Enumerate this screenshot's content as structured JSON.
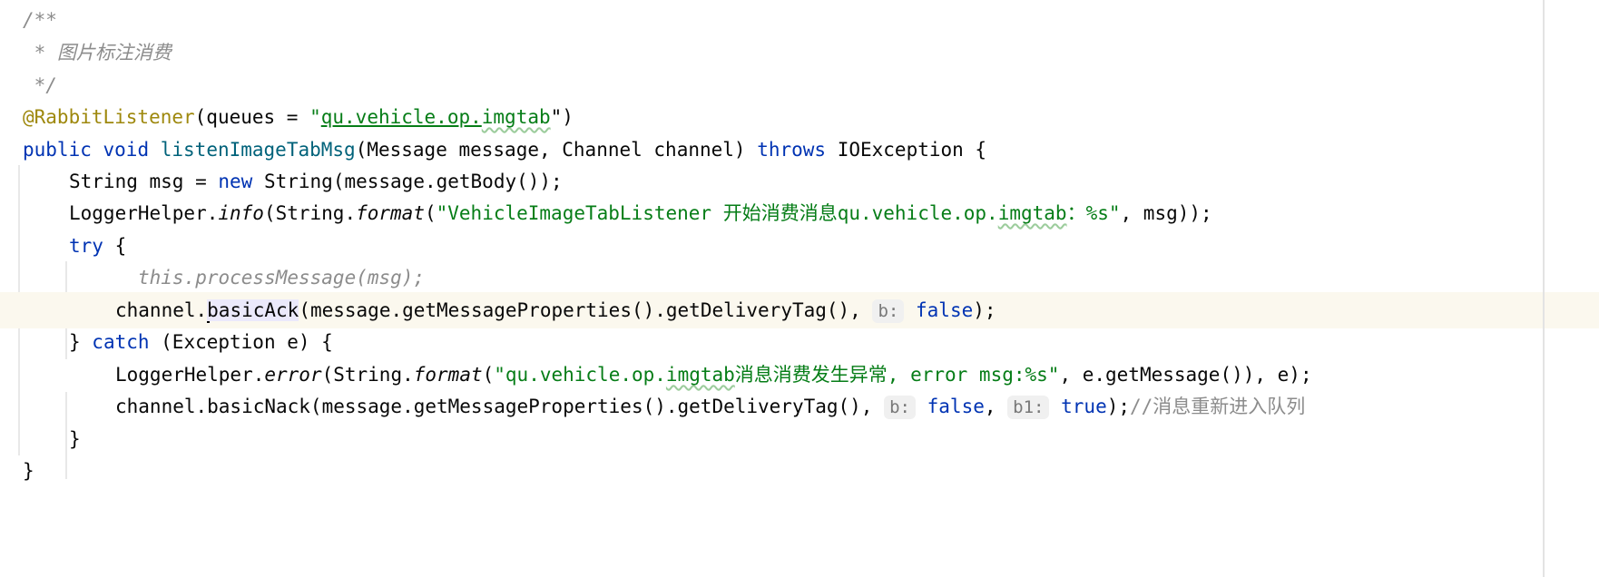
{
  "editor": {
    "language": "java",
    "comment_open": "/**",
    "comment_text": " * 图片标注消费",
    "comment_close": " */",
    "annotation": "@RabbitListener",
    "annotation_args_prefix": "(queues = ",
    "queue_quote_open": "\"",
    "queue_name_underlined": "qu.vehicle.op.",
    "queue_name_typo": "imgtab",
    "queue_quote_close": "\")",
    "sig_public": "public",
    "sig_void": "void",
    "method_name": "listenImageTabMsg",
    "sig_params": "(Message message, Channel channel) ",
    "sig_throws": "throws",
    "sig_exception": " IOException {",
    "line_msg_1": "String msg = ",
    "line_msg_new": "new",
    "line_msg_2": " String(message.getBody());",
    "log_info_1": "LoggerHelper.",
    "log_info_method": "info",
    "log_info_2": "(String.",
    "log_info_format": "format",
    "log_info_3": "(",
    "log_info_str_1": "\"VehicleImageTabListener 开始消费消息qu.vehicle.op.",
    "log_info_str_typo": "imgtab",
    "log_info_str_2": "：%s\"",
    "log_info_4": ", msg));",
    "try_kw": "try",
    "try_brace": " {",
    "process_call": "this.processMessage(msg);",
    "ack_1": "channel.",
    "ack_method": "basicAck",
    "ack_2": "(message.getMessageProperties().getDeliveryTag(), ",
    "ack_hint": "b:",
    "ack_false": "false",
    "ack_3": ");",
    "catch_brace_open": "} ",
    "catch_kw": "catch",
    "catch_rest": " (Exception e) {",
    "log_err_1": "LoggerHelper.",
    "log_err_method": "error",
    "log_err_2": "(String.",
    "log_err_format": "format",
    "log_err_3": "(",
    "log_err_str_1": "\"qu.vehicle.op.",
    "log_err_str_typo": "imgtab",
    "log_err_str_2": "消息消费发生异常, error msg:%s\"",
    "log_err_4": ", e.getMessage()), e);",
    "nack_1": "channel.basicNack(message.getMessageProperties().getDeliveryTag(), ",
    "nack_hint_b": "b:",
    "nack_false": "false",
    "nack_comma": ", ",
    "nack_hint_b1": "b1:",
    "nack_true": "true",
    "nack_end": ");",
    "nack_comment": "//消息重新进入队列",
    "inner_close": "}",
    "outer_close": "}"
  }
}
